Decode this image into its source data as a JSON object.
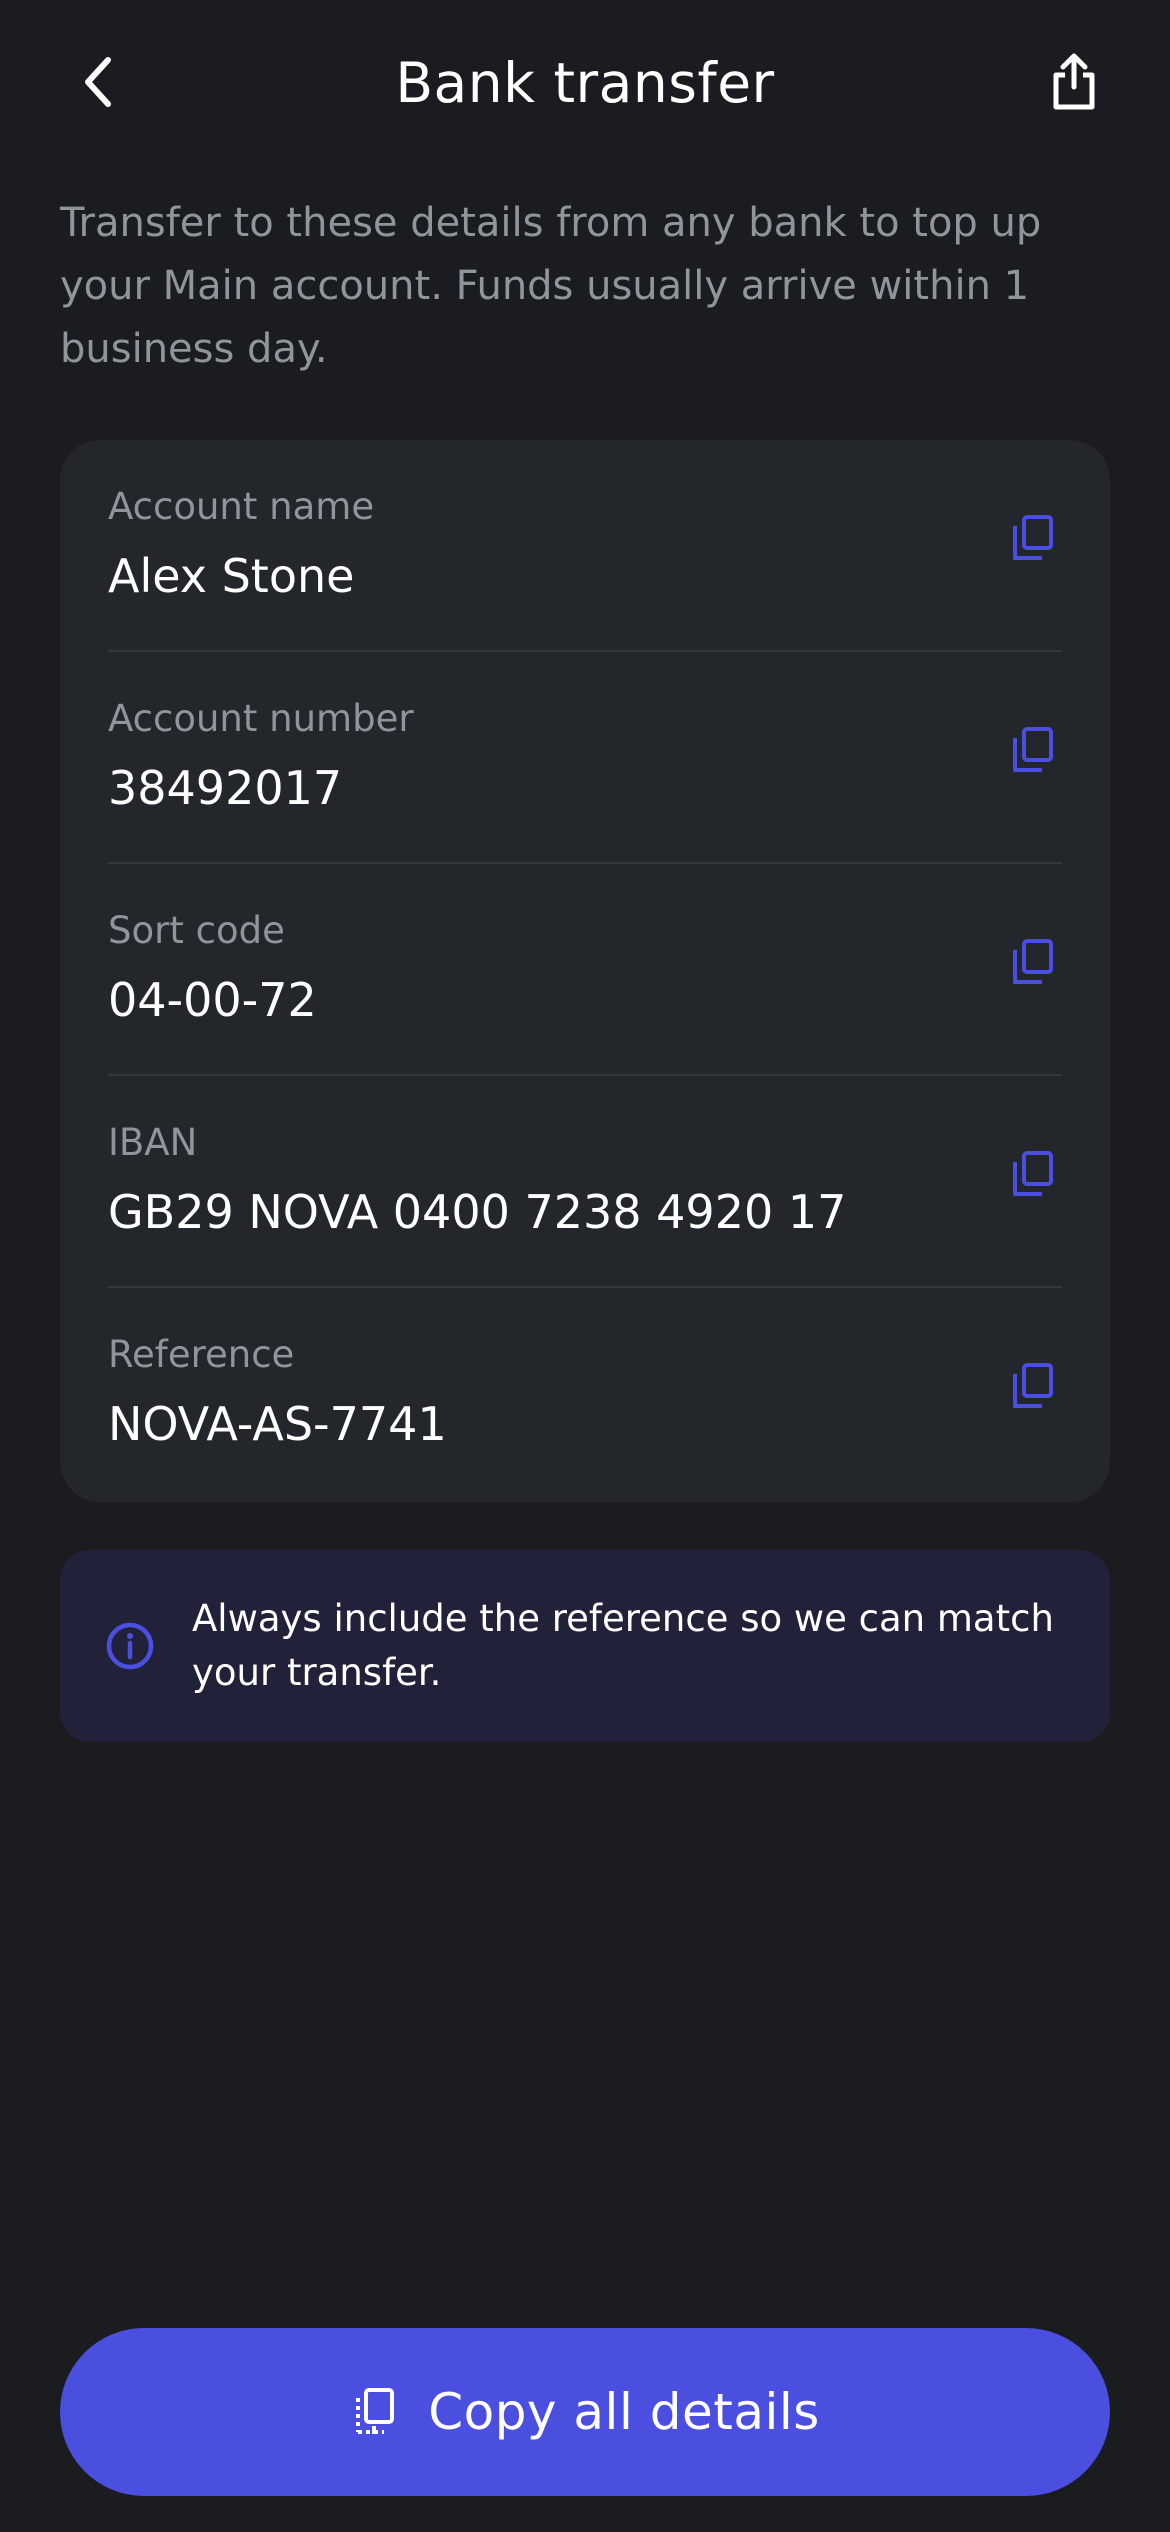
{
  "header": {
    "title": "Bank transfer",
    "back_icon": "chevron-left-icon",
    "share_icon": "share-icon"
  },
  "intro": "Transfer to these details from any bank to top up your Main account. Funds usually arrive within 1 business day.",
  "details": [
    {
      "label": "Account name",
      "value": "Alex Stone"
    },
    {
      "label": "Account number",
      "value": "38492017"
    },
    {
      "label": "Sort code",
      "value": "04-00-72"
    },
    {
      "label": "IBAN",
      "value": "GB29 NOVA 0400 7238 4920 17"
    },
    {
      "label": "Reference",
      "value": "NOVA-AS-7741"
    }
  ],
  "notice": {
    "icon": "info-icon",
    "text": "Always include the reference so we can match your transfer."
  },
  "cta": {
    "label": "Copy all details",
    "icon": "copy-all-icon"
  },
  "colors": {
    "background": "#1a1c1f",
    "card": "#23262a",
    "accent": "#4a4fe0",
    "notice_bg": "#212239",
    "muted_text": "#8f959c"
  }
}
